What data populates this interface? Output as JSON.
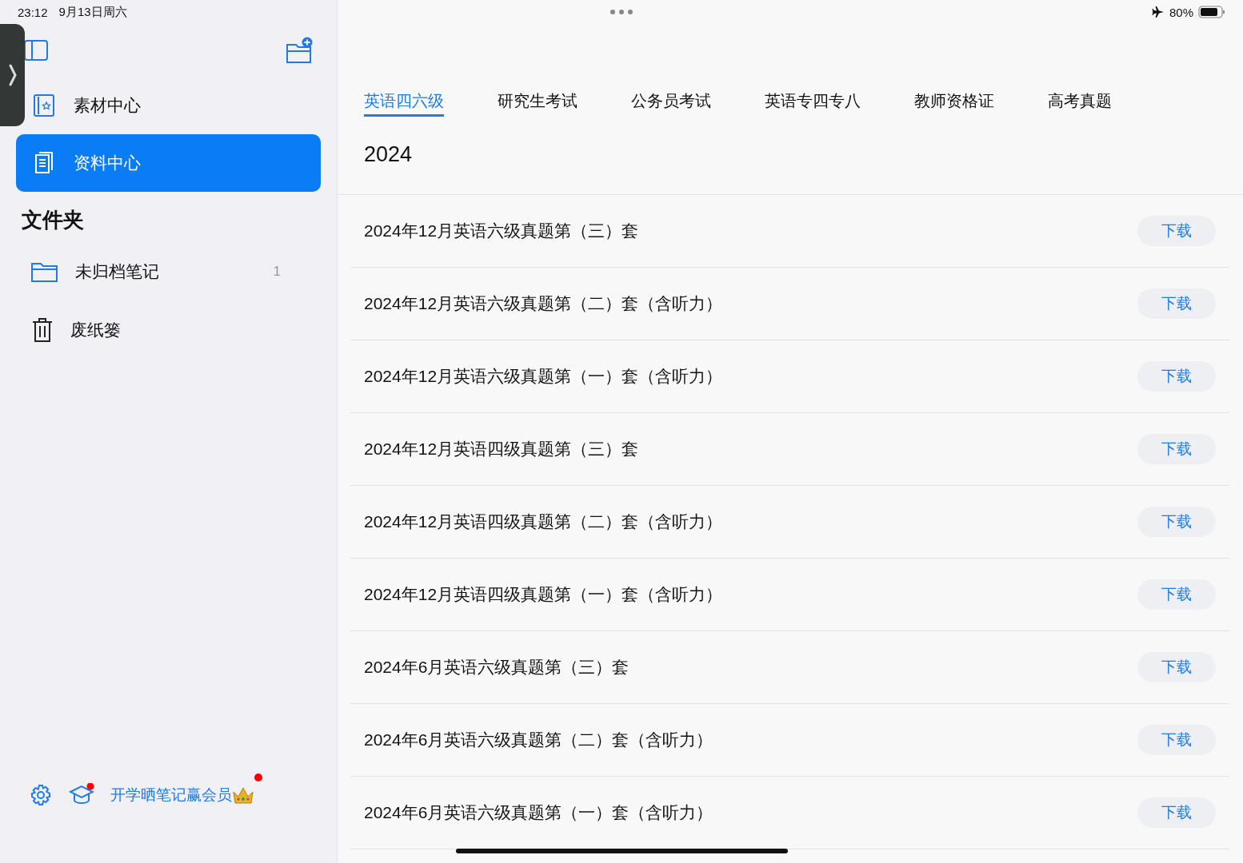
{
  "status_bar": {
    "time": "23:12",
    "date": "9月13日周六",
    "battery": "80%"
  },
  "sidebar": {
    "nav_items": [
      {
        "label": "素材中心",
        "kind": "material",
        "selected": false
      },
      {
        "label": "资料中心",
        "kind": "document",
        "selected": true
      }
    ],
    "folders_heading": "文件夹",
    "folders": [
      {
        "label": "未归档笔记",
        "kind": "folder",
        "count": "1"
      },
      {
        "label": "废纸篓",
        "kind": "trash"
      }
    ],
    "promo": "开学晒笔记赢会员"
  },
  "tabs": [
    {
      "label": "英语四六级",
      "selected": true
    },
    {
      "label": "研究生考试",
      "selected": false
    },
    {
      "label": "公务员考试",
      "selected": false
    },
    {
      "label": "英语专四专八",
      "selected": false
    },
    {
      "label": "教师资格证",
      "selected": false
    },
    {
      "label": "高考真题",
      "selected": false
    }
  ],
  "section_title": "2024",
  "rows": [
    {
      "title": "2024年12月英语六级真题第（三）套",
      "action": "下载"
    },
    {
      "title": "2024年12月英语六级真题第（二）套（含听力）",
      "action": "下载"
    },
    {
      "title": "2024年12月英语六级真题第（一）套（含听力）",
      "action": "下载"
    },
    {
      "title": "2024年12月英语四级真题第（三）套",
      "action": "下载"
    },
    {
      "title": "2024年12月英语四级真题第（二）套（含听力）",
      "action": "下载"
    },
    {
      "title": "2024年12月英语四级真题第（一）套（含听力）",
      "action": "下载"
    },
    {
      "title": "2024年6月英语六级真题第（三）套",
      "action": "下载"
    },
    {
      "title": "2024年6月英语六级真题第（二）套（含听力）",
      "action": "下载"
    },
    {
      "title": "2024年6月英语六级真题第（一）套（含听力）",
      "action": "下载"
    }
  ]
}
